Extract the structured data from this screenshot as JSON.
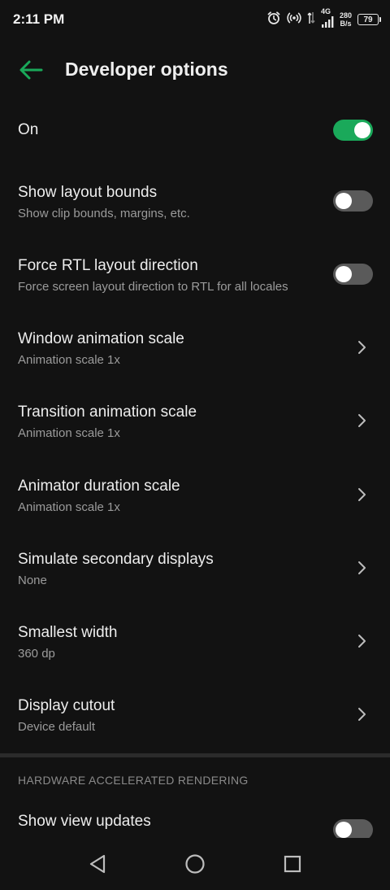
{
  "status": {
    "time": "2:11 PM",
    "network": "4G",
    "speed_value": "280",
    "speed_unit": "B/s",
    "battery": "79"
  },
  "appbar": {
    "title": "Developer options"
  },
  "master_toggle": {
    "label": "On",
    "enabled": true
  },
  "items": [
    {
      "title": "Show layout bounds",
      "subtitle": "Show clip bounds, margins, etc.",
      "control": "toggle",
      "enabled": false
    },
    {
      "title": "Force RTL layout direction",
      "subtitle": "Force screen layout direction to RTL for all locales",
      "control": "toggle",
      "enabled": false
    },
    {
      "title": "Window animation scale",
      "subtitle": "Animation scale 1x",
      "control": "chevron"
    },
    {
      "title": "Transition animation scale",
      "subtitle": "Animation scale 1x",
      "control": "chevron"
    },
    {
      "title": "Animator duration scale",
      "subtitle": "Animation scale 1x",
      "control": "chevron"
    },
    {
      "title": "Simulate secondary displays",
      "subtitle": "None",
      "control": "chevron"
    },
    {
      "title": "Smallest width",
      "subtitle": "360 dp",
      "control": "chevron"
    },
    {
      "title": "Display cutout",
      "subtitle": "Device default",
      "control": "chevron"
    }
  ],
  "section": {
    "header": "HARDWARE ACCELERATED RENDERING",
    "items": [
      {
        "title": "Show view updates",
        "control": "toggle",
        "enabled": false
      }
    ]
  },
  "colors": {
    "background": "#121212",
    "accent": "#1aa95a",
    "toggle_off": "#5a5a5a"
  },
  "icons": {
    "back": "arrow-left-icon",
    "chevron": "chevron-right-icon",
    "nav_back": "triangle-back-icon",
    "nav_home": "circle-home-icon",
    "nav_recents": "square-recents-icon"
  }
}
